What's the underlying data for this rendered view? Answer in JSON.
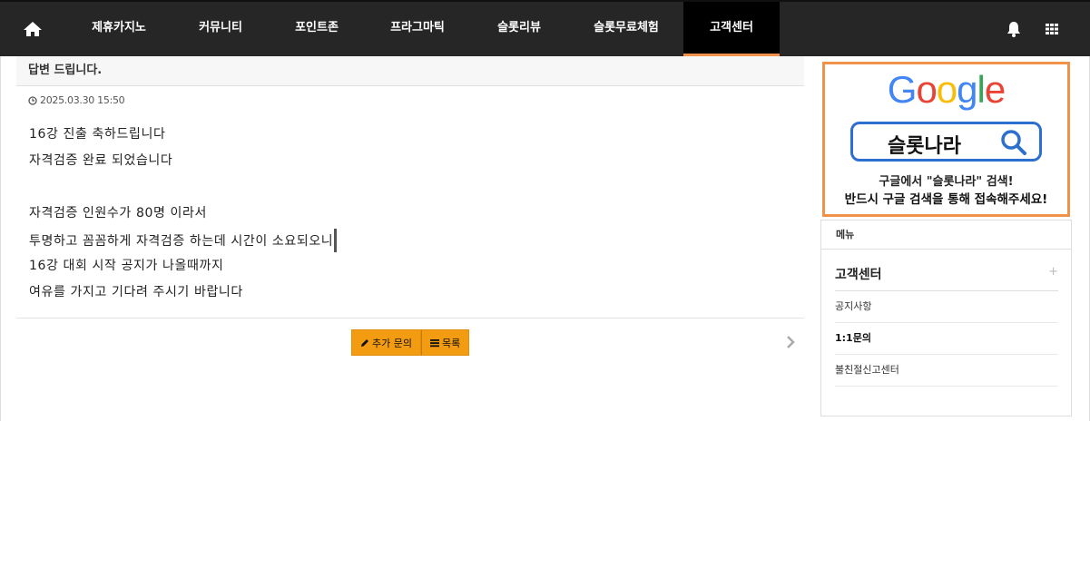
{
  "nav": {
    "home_icon": "home-icon",
    "items": [
      {
        "label": "제휴카지노"
      },
      {
        "label": "커뮤니티"
      },
      {
        "label": "포인트존"
      },
      {
        "label": "프라그마틱"
      },
      {
        "label": "슬롯리뷰"
      },
      {
        "label": "슬롯무료체험"
      },
      {
        "label": "고객센터",
        "active": true
      }
    ],
    "right_icons": [
      "bell-icon",
      "grid-menu-icon"
    ],
    "active_accent": "#f0924a"
  },
  "post": {
    "title": "답변 드립니다.",
    "date": "2025.03.30 15:50",
    "body_lines": [
      "16강 진출 축하드립니다",
      "자격검증 완료 되었습니다",
      "",
      "자격검증 인원수가 80명 이라서",
      "투명하고 꼼꼼하게 자격검증 하는데 시간이 소요되오니",
      "16강 대회 시작 공지가 나올때까지",
      "여유를 가지고 기다려 주시기 바랍니다"
    ],
    "buttons": {
      "add_inquiry": "추가 문의",
      "list": "목록"
    },
    "button_color": "#f39c12"
  },
  "banner": {
    "logo_text": "Google",
    "search_text": "슬롯나라",
    "line1": "구글에서 \"슬롯나라\" 검색!",
    "line2": "반드시 구글 검색을 통해 접속해주세요!",
    "border_color": "#f0924a"
  },
  "sidebar": {
    "header": "메뉴",
    "category": "고객센터",
    "category_toggle": "+",
    "items": [
      {
        "label": "공지사항"
      },
      {
        "label": "1:1문의",
        "active": true
      },
      {
        "label": "불친절신고센터"
      }
    ]
  }
}
